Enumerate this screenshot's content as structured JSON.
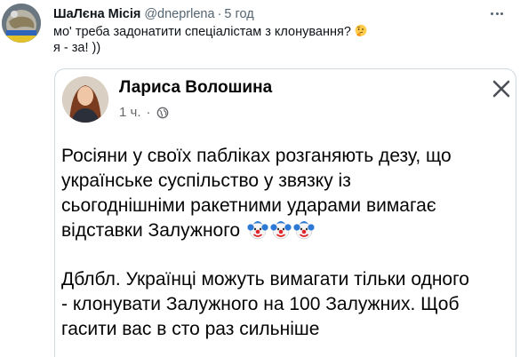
{
  "tweet": {
    "author_name": "ШаЛєна Місія",
    "author_handle": "@dneprlena",
    "separator": "·",
    "time": "5 год",
    "text_line1": "мо' треба задонатити спеціалістам з клонування?",
    "text_line2": "я - за! ))",
    "emoji_icon": "thinking-face-icon"
  },
  "embed": {
    "author_name": "Лариса Волошина",
    "time": "1 ч.",
    "separator": "·",
    "privacy_icon": "globe-icon",
    "close_icon": "close-icon",
    "paragraph1": [
      "Росіяни у своїх пабліках розганяють дезу, що",
      "українське суспільство у звязку із",
      "сьогоднішніми ракетними ударами вимагає",
      "відставки Залужного"
    ],
    "paragraph1_emoji": "clown-face-icon",
    "paragraph2": [
      "Дблбл. Українці можуть вимагати тільки одного",
      "- клонувати Залужного на 100 Залужних. Щоб",
      "гасити вас в сто раз сильніше"
    ]
  },
  "colors": {
    "text_primary": "#0f1419",
    "text_secondary": "#536471",
    "border": "#cfd9de",
    "fb_meta": "#65676b"
  }
}
